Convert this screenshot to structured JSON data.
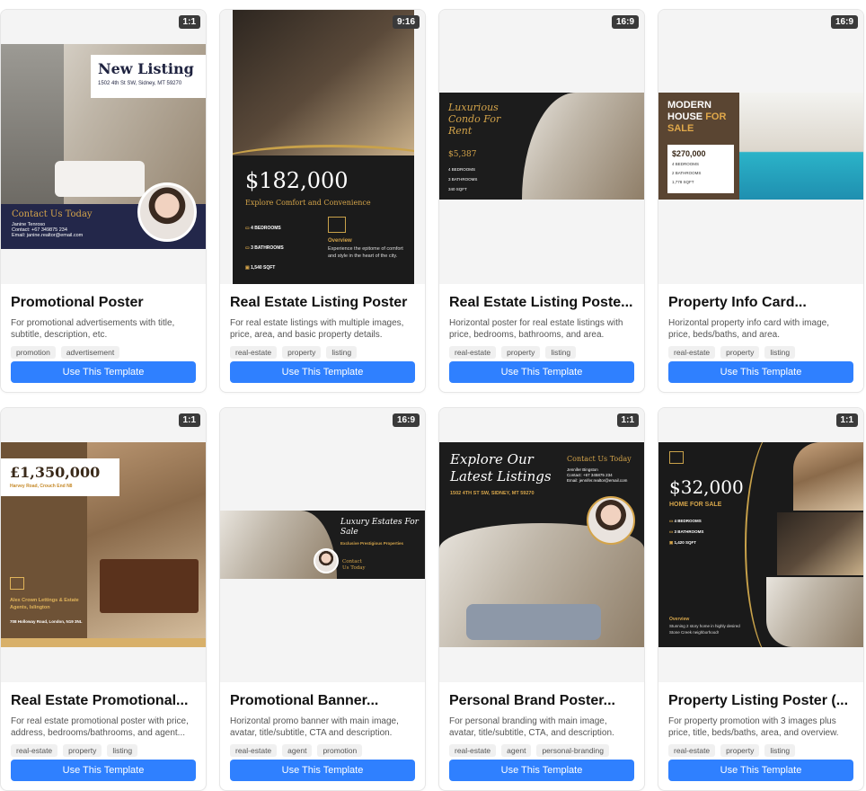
{
  "cards": [
    {
      "ratio": "1:1",
      "title": "Promotional Poster",
      "desc": "For promotional advertisements with title, subtitle, description, etc.",
      "tags": [
        "promotion",
        "advertisement"
      ],
      "button": "Use This Template",
      "art": {
        "heading": "New Listing",
        "address": "1502 4th St SW, Sidney, MT 59270",
        "contact": "Contact Us Today",
        "name": "Janine Tenroso",
        "phone": "Contact: +67 349875 234",
        "email": "Email: janine.realtor@email.com"
      }
    },
    {
      "ratio": "9:16",
      "title": "Real Estate Listing Poster",
      "desc": "For real estate listings with multiple images, price, area, and basic property details.",
      "tags": [
        "real-estate",
        "property",
        "listing"
      ],
      "button": "Use This Template",
      "art": {
        "price": "$182,000",
        "tagline": "Explore Comfort and Convenience",
        "bedrooms": "4 BEDROOMS",
        "bathrooms": "3 BATHROOMS",
        "area": "1,540 SQFT",
        "overview_title": "Overview",
        "overview": "Experience the epitome of comfort and style in the heart of the city."
      }
    },
    {
      "ratio": "16:9",
      "title": "Real Estate Listing Poste...",
      "desc": "Horizontal poster for real estate listings with price, bedrooms, bathrooms, and area.",
      "tags": [
        "real-estate",
        "property",
        "listing"
      ],
      "button": "Use This Template",
      "art": {
        "heading": "Luxurious Condo For Rent",
        "price": "$5,387",
        "bedrooms": "4 BEDROOMS",
        "bathrooms": "3 BATHROOMS",
        "area": "340 SQFT"
      }
    },
    {
      "ratio": "16:9",
      "title": "Property Info Card...",
      "desc": "Horizontal property info card with image, price, beds/baths, and area.",
      "tags": [
        "real-estate",
        "property",
        "listing"
      ],
      "button": "Use This Template",
      "art": {
        "heading1": "MODERN HOUSE",
        "heading2": "FOR SALE",
        "price": "$270,000",
        "bedrooms": "4 BEDROOMS",
        "bathrooms": "2 BATHROOMS",
        "area": "1,778 SQFT"
      }
    },
    {
      "ratio": "1:1",
      "title": "Real Estate Promotional...",
      "desc": "For real estate promotional poster with price, address, bedrooms/bathrooms, and agent...",
      "tags": [
        "real-estate",
        "property",
        "listing"
      ],
      "button": "Use This Template",
      "art": {
        "price": "£1,350,000",
        "address": "Harvey Road, Crouch End N8",
        "agency": "Alex Crown Lettings & Estate Agents, Islington",
        "agency_address": "708 Holloway Road, London, N19 3NL"
      }
    },
    {
      "ratio": "16:9",
      "title": "Promotional Banner...",
      "desc": "Horizontal promo banner with main image, avatar, title/subtitle, CTA and description.",
      "tags": [
        "real-estate",
        "agent",
        "promotion"
      ],
      "button": "Use This Template",
      "art": {
        "heading": "Luxury Estates For Sale",
        "sub": "Exclusive Prestigious Properties",
        "cta": "Contact Us Today"
      }
    },
    {
      "ratio": "1:1",
      "title": "Personal Brand Poster...",
      "desc": "For personal branding with main image, avatar, title/subtitle, CTA, and description.",
      "tags": [
        "real-estate",
        "agent",
        "personal-branding"
      ],
      "button": "Use This Template",
      "art": {
        "heading": "Explore Our Latest Listings",
        "address": "1502 4TH ST SW, SIDNEY, MT 59270",
        "contact": "Contact Us Today",
        "name": "Jennifer Bingston",
        "phone": "Contact: +67 345875 234",
        "email": "Email: jennifer.realtor@email.com"
      }
    },
    {
      "ratio": "1:1",
      "title": "Property Listing Poster (...",
      "desc": "For property promotion with 3 images plus price, title, beds/baths, area, and overview.",
      "tags": [
        "real-estate",
        "property",
        "listing"
      ],
      "button": "Use This Template",
      "art": {
        "price": "$32,000",
        "sub": "HOME FOR SALE",
        "bedrooms": "4 BEDROOMS",
        "bathrooms": "3 BATHROOMS",
        "area": "1,420 SQFT",
        "overview_title": "Overview",
        "overview": "Stunning 2 story home in highly desired Stone Creek neighborhood!"
      }
    }
  ]
}
